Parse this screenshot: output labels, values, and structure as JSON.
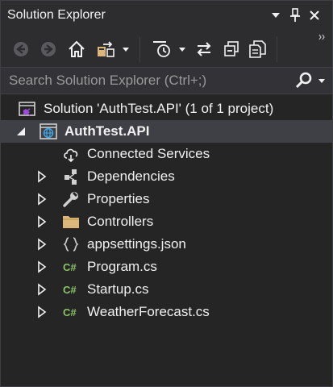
{
  "window": {
    "title": "Solution Explorer"
  },
  "toolbar": {
    "buttons": [
      "back-arrow-icon",
      "forward-arrow-icon",
      "home-icon",
      "switch-views-icon",
      "dropdown-icon",
      "pending-changes-filter-icon",
      "dropdown-icon",
      "sync-with-active-document-icon",
      "collapse-all-icon",
      "show-all-files-icon"
    ]
  },
  "search": {
    "placeholder": "Search Solution Explorer (Ctrl+;)",
    "value": ""
  },
  "tree": {
    "solution": {
      "label": "Solution 'AuthTest.API' (1 of 1 project)"
    },
    "project": {
      "label": "AuthTest.API",
      "expanded": true,
      "selected": true
    },
    "items": [
      {
        "label": "Connected Services",
        "icon": "cloud-icon",
        "expandable": false
      },
      {
        "label": "Dependencies",
        "icon": "dependencies-icon",
        "expandable": true
      },
      {
        "label": "Properties",
        "icon": "wrench-icon",
        "expandable": true
      },
      {
        "label": "Controllers",
        "icon": "folder-icon",
        "expandable": true
      },
      {
        "label": "appsettings.json",
        "icon": "json-file-icon",
        "expandable": true
      },
      {
        "label": "Program.cs",
        "icon": "csharp-file-icon",
        "expandable": true
      },
      {
        "label": "Startup.cs",
        "icon": "csharp-file-icon",
        "expandable": true
      },
      {
        "label": "WeatherForecast.cs",
        "icon": "csharp-file-icon",
        "expandable": true
      }
    ]
  },
  "colors": {
    "background": "#252526",
    "chrome": "#2d2d30",
    "selection": "#3f3f46",
    "folder": "#dcb67a",
    "csharp": "#8cc268",
    "accent": "#9b4fd8"
  }
}
